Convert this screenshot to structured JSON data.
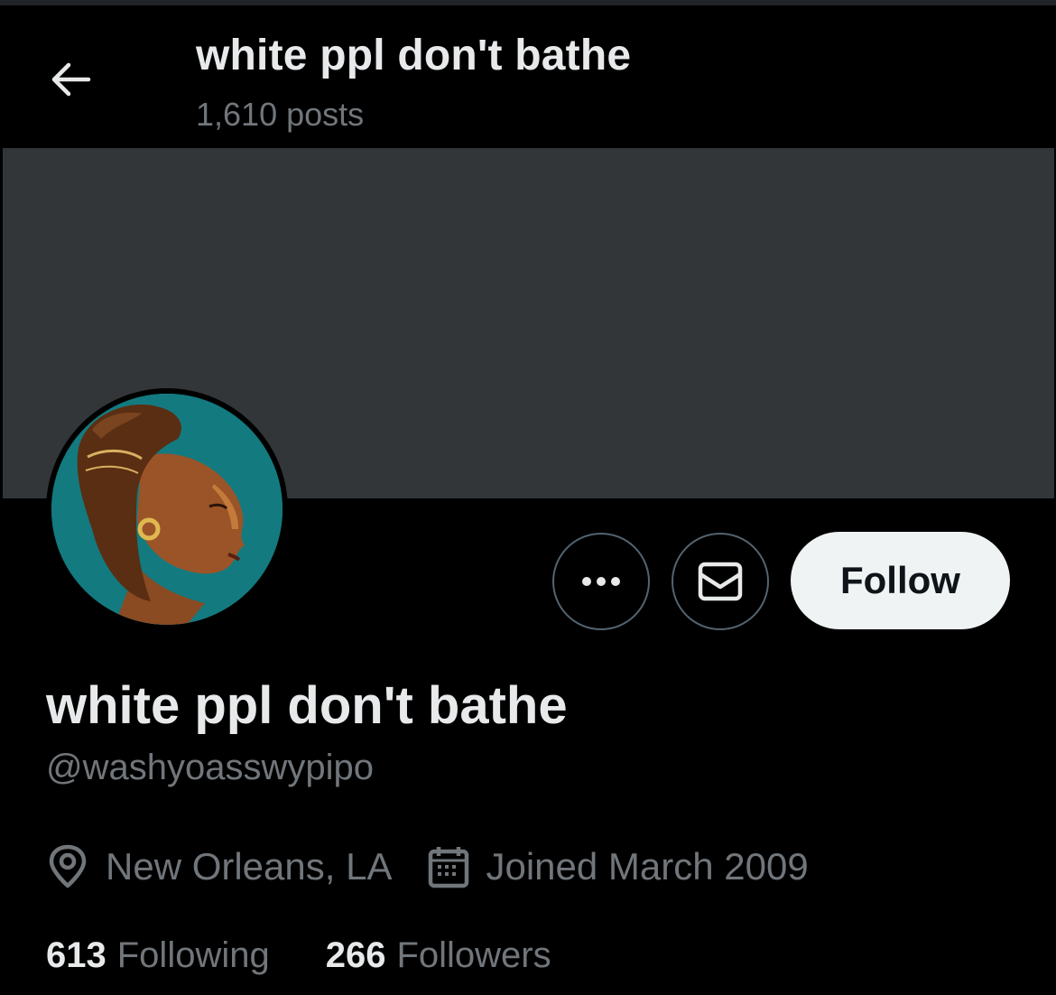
{
  "header": {
    "back_icon": "arrow-left-icon",
    "title": "white ppl don't bathe",
    "post_count": "1,610 posts"
  },
  "banner": {
    "color": "#333639"
  },
  "profile": {
    "avatar": "profile-avatar",
    "display_name": "white ppl don't bathe",
    "handle": "@washyoasswypipo",
    "location_icon": "location-pin-icon",
    "location": "New Orleans, LA",
    "joined_icon": "calendar-icon",
    "joined": "Joined March 2009"
  },
  "actions": {
    "more_icon": "more-dots-icon",
    "message_icon": "envelope-icon",
    "follow_label": "Follow"
  },
  "stats": {
    "following_count": "613",
    "following_label": "Following",
    "followers_count": "266",
    "followers_label": "Followers"
  },
  "colors": {
    "background": "#000000",
    "primary_text": "#e7e9ea",
    "secondary_text": "#71767b",
    "button_border": "#536471",
    "follow_bg": "#eff3f4"
  }
}
